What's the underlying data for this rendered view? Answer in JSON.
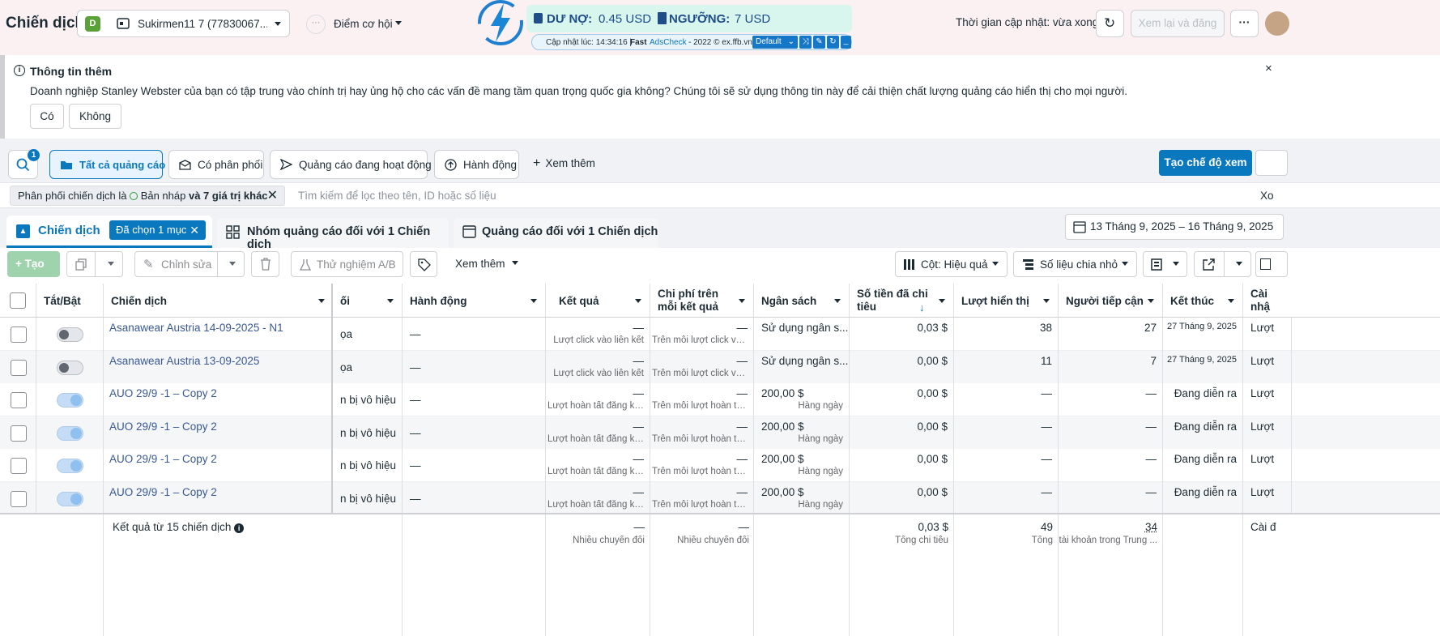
{
  "colors": {
    "brand_blue": "#0a78be",
    "link": "#385898",
    "selected_bg": "#e7f3ff",
    "accent_teal": "#2f95a6"
  },
  "topbar": {
    "title": "Chiến dịch",
    "account_badge": "D",
    "account_name": "Sukirmen11 7 (77830067...",
    "opportunity_label": "Điểm cơ hội",
    "update_time": "Thời gian cập nhật: vừa xong",
    "review_button": "Xem lại và đăng",
    "more_icon": "ellipsis-icon"
  },
  "adscheck": {
    "debt_label": "DƯ NỢ:",
    "debt_value": "0.45 USD",
    "threshold_label": "NGƯỠNG:",
    "threshold_value": "7 USD",
    "updated_prefix": "Cập nhật lúc: 14:34:16 |",
    "brand_fast": "Fast",
    "brand_ads": "AdsCheck",
    "brand_suffix": "- 2022 © ex.ffb.vn",
    "profile_select": "Default"
  },
  "infobox": {
    "title": "Thông tin thêm",
    "body": "Doanh nghiệp Stanley Webster của bạn có tập trung vào chính trị hay ủng hộ cho các vấn đề mang tầm quan trọng quốc gia không? Chúng tôi sẽ sử dụng thông tin này để cải thiện chất lượng quảng cáo hiển thị cho mọi người.",
    "yes": "Có",
    "no": "Không"
  },
  "filters": {
    "search_badge": "1",
    "all_ads": "Tất cả quảng cáo",
    "has_delivery": "Có phân phối",
    "active_ads": "Quảng cáo đang hoạt động",
    "actions": "Hành động",
    "see_more": "Xem thêm",
    "create_view": "Tạo chế độ xem",
    "chip_prefix": "Phân phối chiến dịch là",
    "chip_value": "Bản nháp",
    "chip_suffix": "và 7 giá trị khác",
    "search_placeholder": "Tìm kiếm để lọc theo tên, ID hoặc số liệu",
    "clear_partial": "Xo"
  },
  "tabs": {
    "campaigns": "Chiến dịch",
    "selected_badge": "Đã chọn 1 mục",
    "adsets": "Nhóm quảng cáo đối với 1 Chiến dịch",
    "ads": "Quảng cáo đối với 1 Chiến dịch",
    "date_range": "13 Tháng 9, 2025 – 16 Tháng 9, 2025"
  },
  "toolbar": {
    "create": "Tạo",
    "edit": "Chỉnh sửa",
    "ab_test": "Thử nghiệm A/B",
    "more": "Xem thêm",
    "columns": "Cột: Hiệu quả",
    "breakdown": "Số liệu chia nhỏ"
  },
  "table": {
    "headers": {
      "toggle": "Tắt/Bật",
      "campaign": "Chiến dịch",
      "delivery": "ối",
      "actions": "Hành động",
      "results": "Kết quả",
      "cost_per_result": "Chi phí trên mỗi kết quả",
      "budget": "Ngân sách",
      "amount_spent": "Số tiền đã chi tiêu",
      "impressions": "Lượt hiển thị",
      "reach": "Người tiếp cận",
      "ends": "Kết thúc",
      "settings": "Cài nhậ"
    },
    "rows": [
      {
        "name": "Asanawear Austria 14-09-2025 - N1",
        "toggle": "off",
        "delivery": "ọa",
        "actions": "—",
        "results": "—",
        "results_sub": "Lượt click vào liên kết",
        "cpr": "—",
        "cpr_sub": "Trên mỗi lượt click và...",
        "budget": "Sử dụng ngân s...",
        "budget_sub": "",
        "spent": "0,03 $",
        "impressions": "38",
        "reach": "27",
        "ends": "27 Tháng 9, 2025",
        "settings": "Lượt"
      },
      {
        "name": "Asanawear Austria 13-09-2025",
        "toggle": "off",
        "delivery": "ọa",
        "actions": "—",
        "results": "—",
        "results_sub": "Lượt click vào liên kết",
        "cpr": "—",
        "cpr_sub": "Trên mỗi lượt click và...",
        "budget": "Sử dụng ngân s...",
        "budget_sub": "",
        "spent": "0,00 $",
        "impressions": "11",
        "reach": "7",
        "ends": "27 Tháng 9, 2025",
        "settings": "Lượt"
      },
      {
        "name": "AUO 29/9 -1 – Copy 2",
        "toggle": "on",
        "delivery": "n bị vô hiệu",
        "actions": "—",
        "results": "—",
        "results_sub": "Lượt hoàn tất đăng ký...",
        "cpr": "—",
        "cpr_sub": "Trên mỗi lượt hoàn tất...",
        "budget": "200,00 $",
        "budget_sub": "Hàng ngày",
        "spent": "0,00 $",
        "impressions": "—",
        "reach": "—",
        "ends": "Đang diễn ra",
        "settings": "Lượt"
      },
      {
        "name": "AUO 29/9 -1 – Copy 2",
        "toggle": "on",
        "delivery": "n bị vô hiệu",
        "actions": "—",
        "results": "—",
        "results_sub": "Lượt hoàn tất đăng ký...",
        "cpr": "—",
        "cpr_sub": "Trên mỗi lượt hoàn tất...",
        "budget": "200,00 $",
        "budget_sub": "Hàng ngày",
        "spent": "0,00 $",
        "impressions": "—",
        "reach": "—",
        "ends": "Đang diễn ra",
        "settings": "Lượt"
      },
      {
        "name": "AUO 29/9 -1 – Copy 2",
        "toggle": "on",
        "delivery": "n bị vô hiệu",
        "actions": "—",
        "results": "—",
        "results_sub": "Lượt hoàn tất đăng ký...",
        "cpr": "—",
        "cpr_sub": "Trên mỗi lượt hoàn tất...",
        "budget": "200,00 $",
        "budget_sub": "Hàng ngày",
        "spent": "0,00 $",
        "impressions": "—",
        "reach": "—",
        "ends": "Đang diễn ra",
        "settings": "Lượt"
      },
      {
        "name": "AUO 29/9 -1 – Copy 2",
        "toggle": "on",
        "delivery": "n bị vô hiệu",
        "actions": "—",
        "results": "—",
        "results_sub": "Lượt hoàn tất đăng ký...",
        "cpr": "—",
        "cpr_sub": "Trên mỗi lượt hoàn tất...",
        "budget": "200,00 $",
        "budget_sub": "Hàng ngày",
        "spent": "0,00 $",
        "impressions": "—",
        "reach": "—",
        "ends": "Đang diễn ra",
        "settings": "Lượt"
      }
    ],
    "footer": {
      "label": "Kết quả từ 15 chiến dịch",
      "results": "—",
      "results_sub": "Nhiều chuyển đổi",
      "cpr": "—",
      "cpr_sub": "Nhiều chuyển đổi",
      "spent": "0,03 $",
      "spent_sub": "Tổng chi tiêu",
      "impressions": "49",
      "impressions_sub": "Tổng",
      "reach": "34",
      "reach_sub": "tài khoản trong Trung ...",
      "settings": "Cài đ"
    }
  }
}
